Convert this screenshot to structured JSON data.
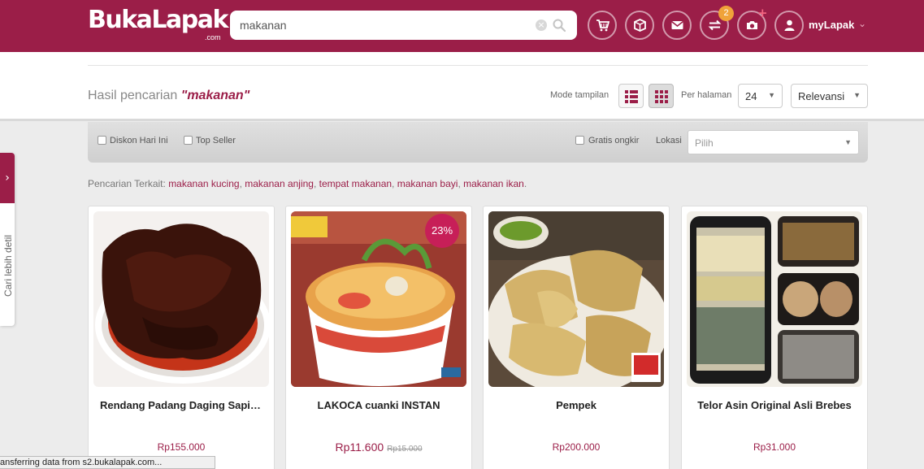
{
  "header": {
    "logo": "BukaLapak",
    "logo_suffix": ".com",
    "search_value": "makanan",
    "notification_count": "2",
    "account_label": "myLapak",
    "icons": [
      "cart-icon",
      "box-icon",
      "mail-icon",
      "transfer-icon",
      "camera-plus-icon",
      "user-icon"
    ],
    "brand_color": "#9b1e48"
  },
  "results": {
    "label": "Hasil pencarian",
    "query": "\"makanan\"",
    "mode_label": "Mode tampilan",
    "per_page_label": "Per halaman",
    "per_page_value": "24",
    "sort_value": "Relevansi"
  },
  "filters": {
    "discount_today": "Diskon Hari Ini",
    "top_seller": "Top Seller",
    "free_shipping": "Gratis ongkir",
    "location_label": "Lokasi",
    "location_placeholder": "Pilih"
  },
  "related": {
    "label": "Pencarian Terkait:",
    "items": [
      "makanan kucing",
      "makanan anjing",
      "tempat makanan",
      "makanan bayi",
      "makanan ikan"
    ]
  },
  "sidetab": {
    "arrow": "›",
    "label": "Cari lebih detil"
  },
  "products": [
    {
      "name": "Rendang Padang Daging Sapi Asli",
      "price": "Rp155.000",
      "old_price": "",
      "discount": ""
    },
    {
      "name": "LAKOCA cuanki INSTAN",
      "price": "Rp11.600",
      "old_price": "Rp15.000",
      "discount": "23%"
    },
    {
      "name": "Pempek",
      "price": "Rp200.000",
      "old_price": "",
      "discount": ""
    },
    {
      "name": "Telor Asin Original Asli Brebes",
      "price": "Rp31.000",
      "old_price": "",
      "discount": ""
    }
  ],
  "status_bar": "ansferring data from s2.bukalapak.com..."
}
